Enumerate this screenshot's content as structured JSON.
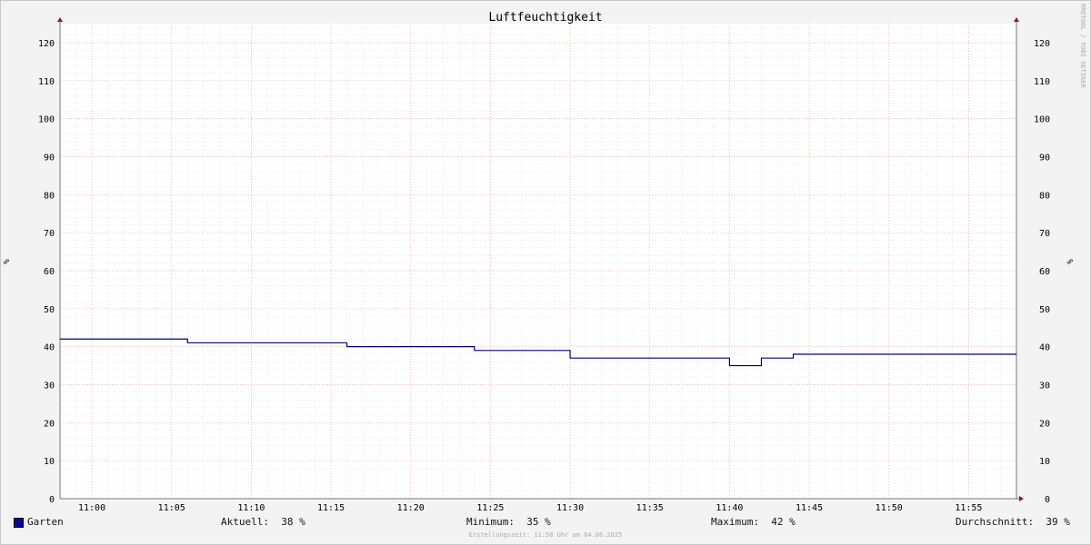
{
  "chart_data": {
    "type": "line",
    "title": "Luftfeuchtigkeit",
    "ylabel": "%",
    "ylim": [
      0,
      125
    ],
    "yticks": [
      0,
      10,
      20,
      30,
      40,
      50,
      60,
      70,
      80,
      90,
      100,
      110,
      120
    ],
    "xlim": [
      "10:58",
      "11:58"
    ],
    "xticks": [
      "11:00",
      "11:05",
      "11:10",
      "11:15",
      "11:20",
      "11:25",
      "11:30",
      "11:35",
      "11:40",
      "11:45",
      "11:50",
      "11:55"
    ],
    "grid": true,
    "series": [
      {
        "name": "Garten",
        "color": "#000080",
        "step": true,
        "x": [
          "10:58",
          "11:06",
          "11:16",
          "11:24",
          "11:30",
          "11:40",
          "11:42",
          "11:44",
          "11:58"
        ],
        "y": [
          42,
          41,
          40,
          39,
          37,
          35,
          37,
          38,
          38
        ]
      }
    ]
  },
  "legend": {
    "series_name": "Garten",
    "swatch_color": "#0a0a9a",
    "aktuell": "Aktuell:  38 %",
    "minimum": "Minimum:  35 %",
    "maximum": "Maximum:  42 %",
    "durchschnitt": "Durchschnitt:  39 %"
  },
  "footer": "Erstellungszeit: 11:58 Uhr am 04.06.2025",
  "watermark": "RRDTOOL / TOBI OETIKER"
}
